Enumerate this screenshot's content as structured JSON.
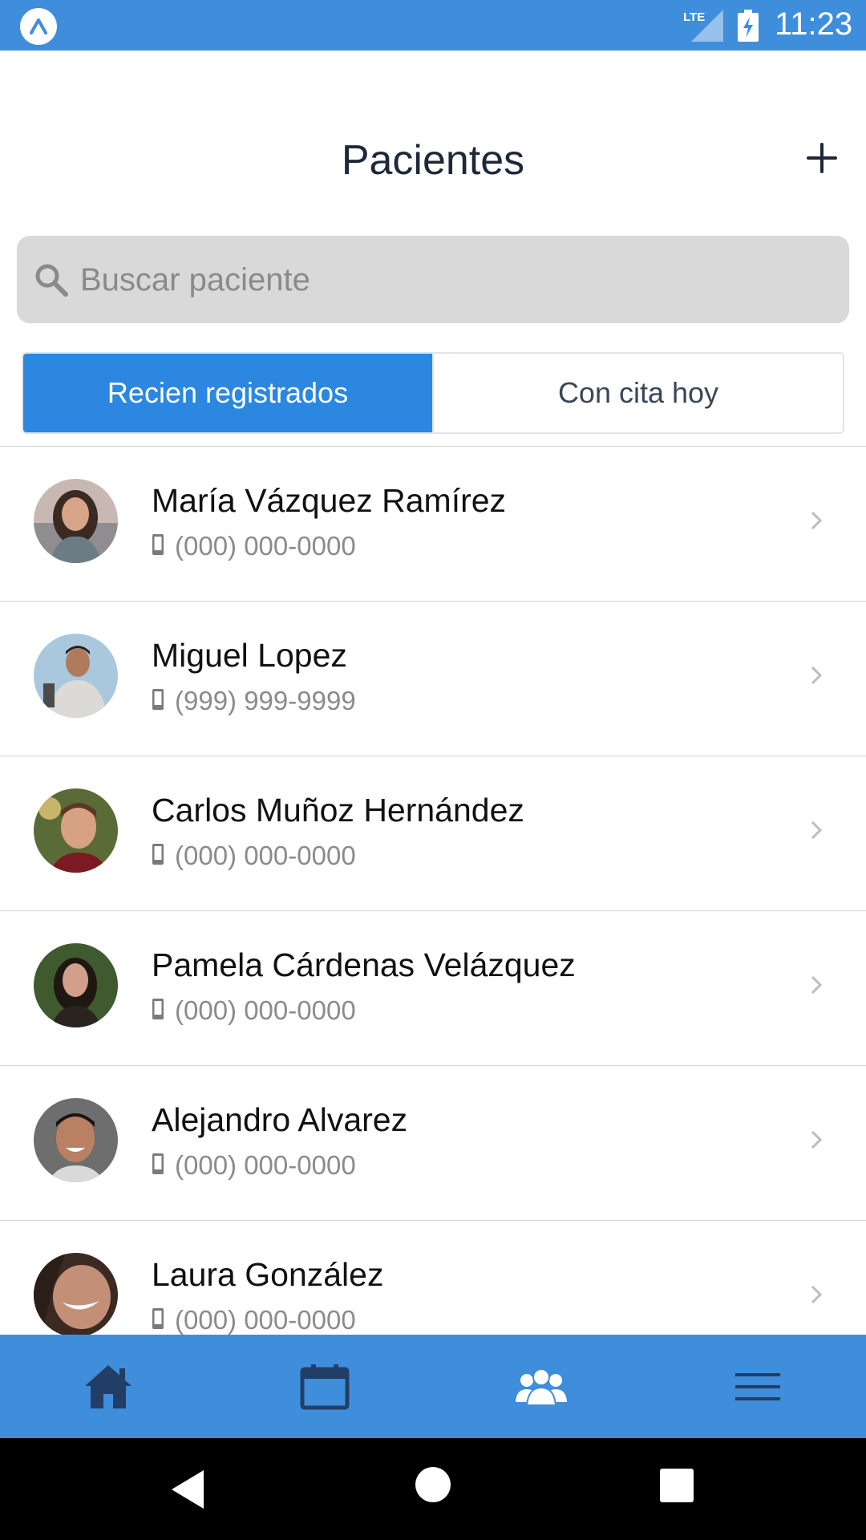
{
  "status_bar": {
    "app_icon": "expo-logo-icon",
    "network": "LTE",
    "time": "11:23",
    "color": "#3f8edc"
  },
  "header": {
    "title": "Pacientes",
    "add_icon": "plus-icon"
  },
  "search": {
    "placeholder": "Buscar paciente",
    "value": "",
    "icon": "search-icon"
  },
  "tabs": [
    {
      "label": "Recien registrados",
      "active": true
    },
    {
      "label": "Con cita hoy",
      "active": false
    }
  ],
  "patients": [
    {
      "name": "María Vázquez Ramírez",
      "phone": "(000) 000-0000"
    },
    {
      "name": "Miguel Lopez",
      "phone": "(999) 999-9999"
    },
    {
      "name": "Carlos Muñoz Hernández",
      "phone": "(000) 000-0000"
    },
    {
      "name": "Pamela Cárdenas Velázquez",
      "phone": "(000) 000-0000"
    },
    {
      "name": "Alejandro Alvarez",
      "phone": "(000) 000-0000"
    },
    {
      "name": "Laura González",
      "phone": "(000) 000-0000"
    }
  ],
  "tab_bar": {
    "items": [
      {
        "icon": "home-icon",
        "active": false
      },
      {
        "icon": "calendar-icon",
        "active": false
      },
      {
        "icon": "patients-group-icon",
        "active": true
      },
      {
        "icon": "menu-icon",
        "active": false
      }
    ],
    "background": "#3f8edc",
    "active_color": "#ffffff",
    "inactive_color": "#233e66"
  },
  "colors": {
    "accent": "#2b87df",
    "title": "#1e2838",
    "secondary_text": "#8b8b8b"
  }
}
